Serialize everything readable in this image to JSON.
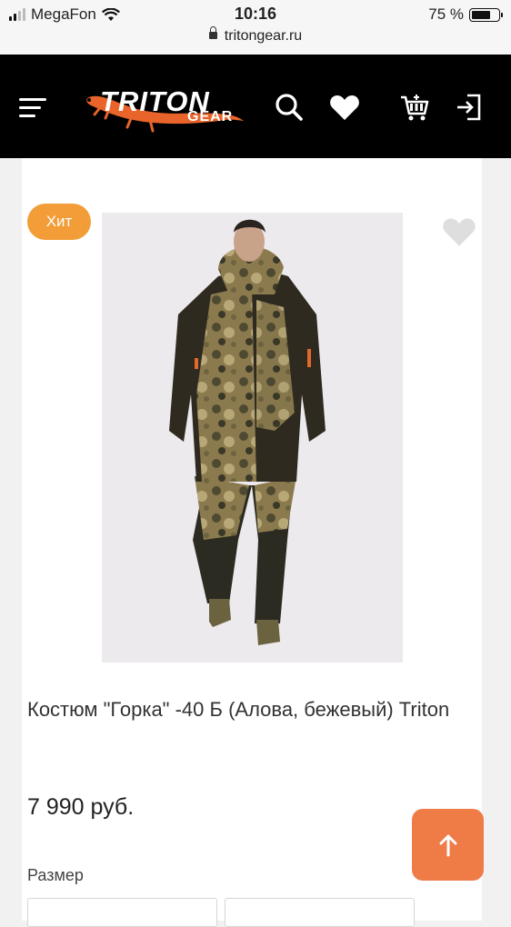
{
  "status_bar": {
    "carrier": "MegaFon",
    "time": "10:16",
    "battery": "75 %",
    "battery_level": 0.75,
    "url": "tritongear.ru"
  },
  "header": {
    "logo_main": "TRITON",
    "logo_sub": "GEAR",
    "icons": [
      "menu-icon",
      "search-icon",
      "heart-icon",
      "cart-icon",
      "login-icon"
    ]
  },
  "product": {
    "badge": "Хит",
    "title": "Костюм \"Горка\" -40 Б (Алова, бежевый) Triton",
    "price": "7 990 руб.",
    "size_label": "Размер"
  },
  "colors": {
    "header_bg": "#000000",
    "badge": "#f29d38",
    "scroll_top": "#ef7b47",
    "logo_accent": "#e8642a"
  }
}
